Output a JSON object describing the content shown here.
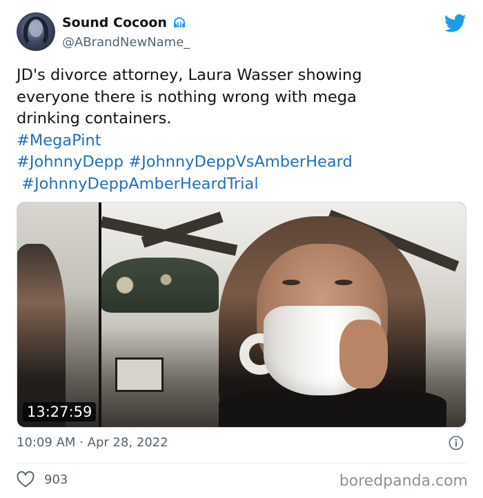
{
  "author": {
    "display_name": "Sound Cocoon",
    "handle": "@ABrandNewName_",
    "name_icon": "headphones-icon"
  },
  "platform_icon": "twitter-bird-icon",
  "tweet": {
    "text_lines": [
      "JD's divorce attorney, Laura Wasser showing",
      "everyone there is nothing wrong with mega",
      "drinking containers."
    ],
    "hashtags": {
      "line1": "#MegaPint",
      "line2a": "#JohnnyDepp",
      "line2b": "#JohnnyDeppVsAmberHeard",
      "line3": "#JohnnyDeppAmberHeardTrial"
    }
  },
  "media": {
    "timestamp_overlay": "13:27:59"
  },
  "meta": {
    "time": "10:09 AM",
    "separator": "·",
    "date": "Apr 28, 2022",
    "info_icon": "info-icon"
  },
  "engagement": {
    "like_icon": "heart-icon",
    "like_count": "903"
  },
  "watermark": "boredpanda.com",
  "colors": {
    "hashtag": "#1d6fc2",
    "twitter_blue": "#1d9bf0",
    "secondary_text": "#536471"
  }
}
